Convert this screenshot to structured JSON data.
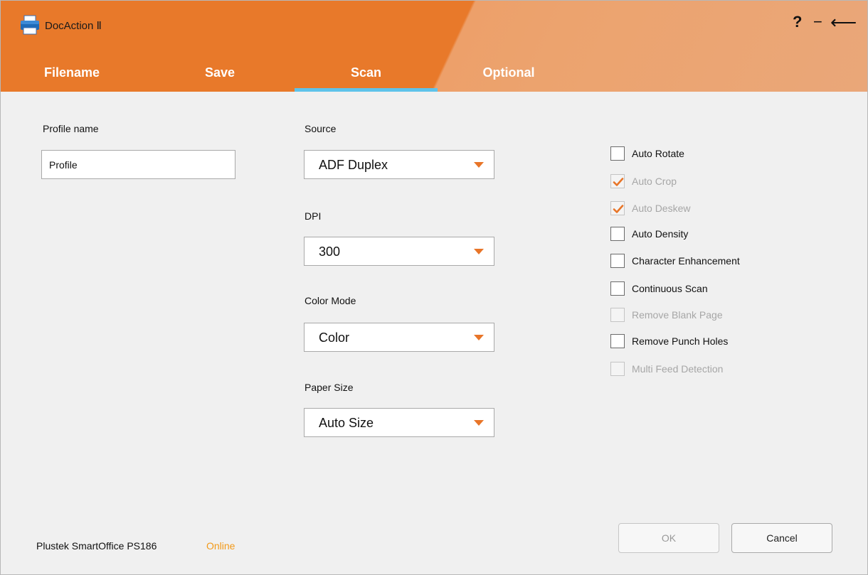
{
  "app": {
    "title": "DocAction Ⅱ",
    "help_label": "?",
    "minimize_label": "−",
    "back_label": "⟵"
  },
  "tabs": [
    {
      "label": "Filename",
      "active": false
    },
    {
      "label": "Save",
      "active": false
    },
    {
      "label": "Scan",
      "active": true
    },
    {
      "label": "Optional",
      "active": false
    }
  ],
  "profile": {
    "label": "Profile name",
    "value": "Profile"
  },
  "selects": {
    "source": {
      "label": "Source",
      "value": "ADF Duplex"
    },
    "dpi": {
      "label": "DPI",
      "value": "300"
    },
    "color_mode": {
      "label": "Color Mode",
      "value": "Color"
    },
    "paper_size": {
      "label": "Paper Size",
      "value": "Auto Size"
    }
  },
  "options": [
    {
      "label": "Auto Rotate",
      "checked": false,
      "disabled": false
    },
    {
      "label": "Auto Crop",
      "checked": true,
      "disabled": true
    },
    {
      "label": "Auto Deskew",
      "checked": true,
      "disabled": true
    },
    {
      "label": "Auto Density",
      "checked": false,
      "disabled": false
    },
    {
      "label": "Character Enhancement",
      "checked": false,
      "disabled": false
    },
    {
      "label": "Continuous Scan",
      "checked": false,
      "disabled": false
    },
    {
      "label": "Remove Blank Page",
      "checked": false,
      "disabled": true
    },
    {
      "label": "Remove Punch Holes",
      "checked": false,
      "disabled": false
    },
    {
      "label": "Multi Feed Detection",
      "checked": false,
      "disabled": true
    }
  ],
  "status": {
    "device": "Plustek SmartOffice PS186",
    "state": "Online"
  },
  "buttons": {
    "ok": "OK",
    "cancel": "Cancel"
  },
  "colors": {
    "accent": "#e8792a",
    "tab_indicator": "#5ec3ea",
    "online": "#f29a1a",
    "checkmark": "#e87528"
  },
  "icons": {
    "app": "printer-icon",
    "help": "help-icon",
    "minimize": "minimize-icon",
    "back": "back-arrow-icon",
    "dropdown": "dropdown-arrow-icon",
    "check": "checkmark-icon"
  }
}
